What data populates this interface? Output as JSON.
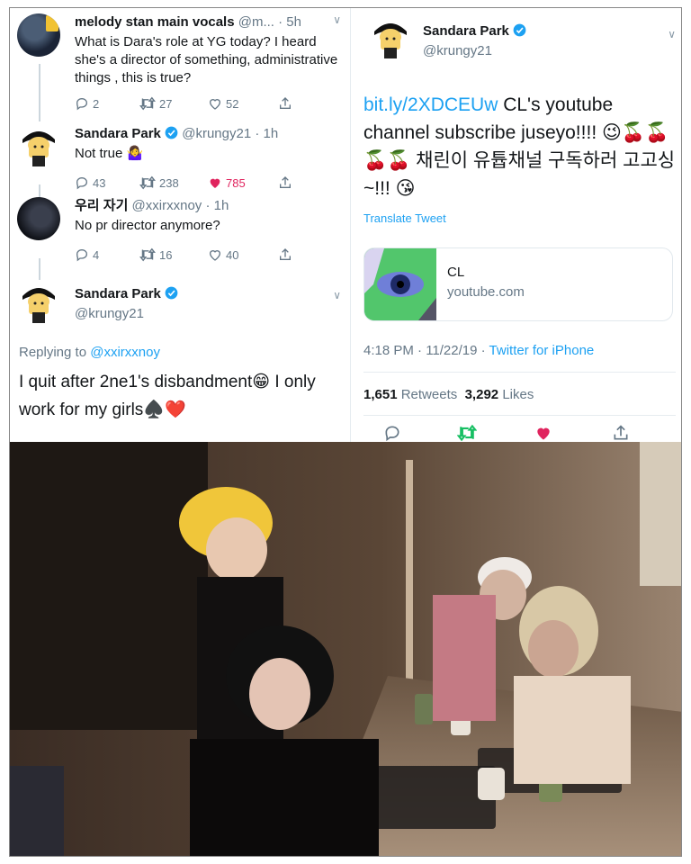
{
  "thread": {
    "tweet1": {
      "name": "melody stan main vocals",
      "handle_time": "@m... · 5h",
      "text": "What is Dara's role at YG today? I heard she's a director of something, administrative things , this is true?",
      "replies": "2",
      "retweets": "27",
      "likes": "52"
    },
    "tweet2": {
      "name": "Sandara Park",
      "handle_time": "@krungy21 · 1h",
      "text": "Not true 🤷‍♀️",
      "replies": "43",
      "retweets": "238",
      "likes": "785"
    },
    "tweet3": {
      "name": "우리 자기",
      "handle_time": "@xxirxxnoy · 1h",
      "text": "No pr director anymore?",
      "replies": "4",
      "retweets": "16",
      "likes": "40"
    },
    "tweet4": {
      "name": "Sandara Park",
      "handle": "@krungy21",
      "reply_prefix": "Replying to",
      "reply_mention": "@xxirxxnoy",
      "text": "I quit after 2ne1's disbandment😁 I only work for my girls♠️❤️"
    }
  },
  "main_tweet": {
    "name": "Sandara Park",
    "handle": "@krungy21",
    "link": "bit.ly/2XDCEUw",
    "text": " CL's youtube channel subscribe juseyo!!!! 😉🍒🍒🍒🍒 채린이 유튭채널 구독하러 고고싱~!!! 😘",
    "translate": "Translate Tweet",
    "card": {
      "title": "CL",
      "domain": "youtube.com"
    },
    "time": "4:18 PM · 11/22/19 ·",
    "via": "Twitter for iPhone",
    "retweets": "1,651",
    "retweets_label": "Retweets",
    "likes": "3,292",
    "likes_label": "Likes"
  },
  "colors": {
    "accent": "#1da1f2",
    "like": "#e0245e",
    "retweet_active": "#17bf63",
    "muted": "#657786"
  },
  "icons": [
    "reply-icon",
    "retweet-icon",
    "like-icon",
    "share-icon",
    "verified-icon",
    "chevron-down-icon"
  ]
}
